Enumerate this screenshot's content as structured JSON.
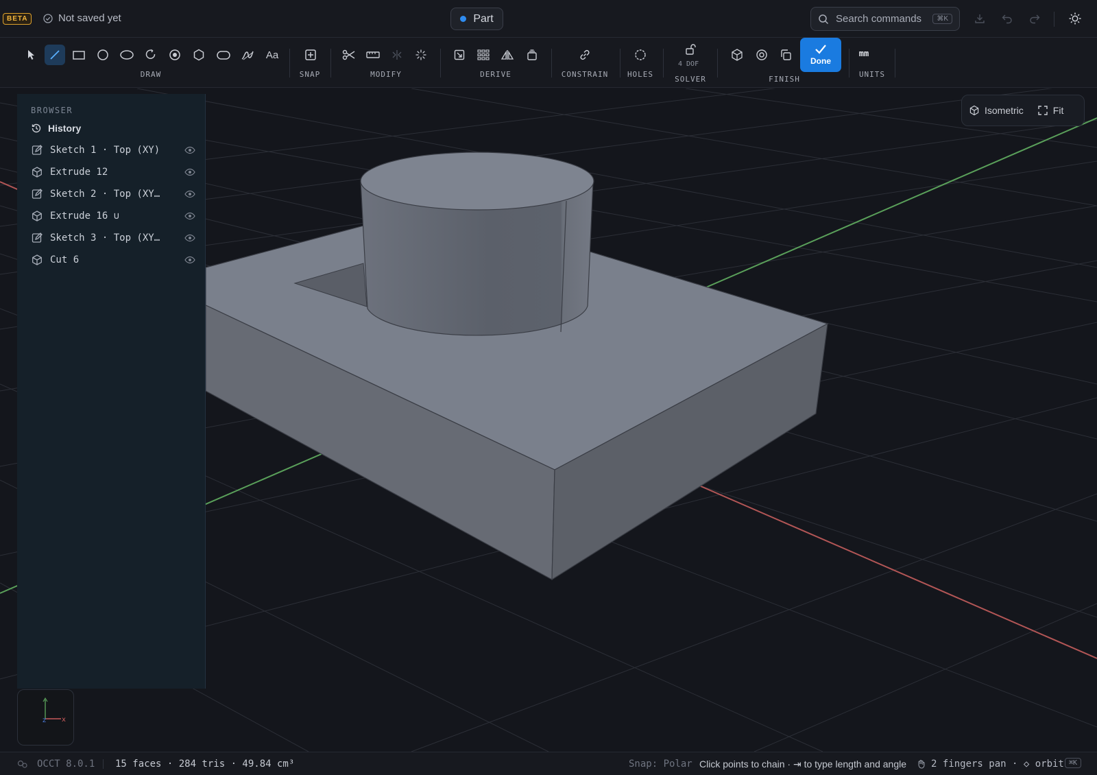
{
  "topbar": {
    "beta": "BETA",
    "save_status": "Not saved yet",
    "document_type": "Part",
    "search_placeholder": "Search commands",
    "search_shortcut": "⌘K"
  },
  "toolbar": {
    "groups": {
      "draw": "DRAW",
      "snap": "SNAP",
      "modify": "MODIFY",
      "derive": "DERIVE",
      "constrain": "CONSTRAIN",
      "holes": "HOLES",
      "solver": "SOLVER",
      "finish": "FINISH",
      "units": "UNITS"
    },
    "dof": "4 DOF",
    "done_label": "Done",
    "units_value": "mm",
    "text_tool": "Aa"
  },
  "browser": {
    "title": "BROWSER",
    "history_label": "History",
    "items": [
      {
        "label": "Sketch 1 · Top (XY)",
        "icon": "sketch-icon"
      },
      {
        "label": "Extrude 12",
        "icon": "cube-icon"
      },
      {
        "label": "Sketch 2 · Top (XY…",
        "icon": "sketch-icon"
      },
      {
        "label": "Extrude 16 ∪",
        "icon": "cube-icon"
      },
      {
        "label": "Sketch 3 · Top (XY…",
        "icon": "sketch-icon"
      },
      {
        "label": "Cut 6",
        "icon": "cube-icon"
      }
    ]
  },
  "view": {
    "isometric_label": "Isometric",
    "fit_label": "Fit"
  },
  "statusbar": {
    "kernel": "OCCT 8.0.1",
    "stats": "15 faces · 284 tris · 49.84 cm³",
    "snap": "Snap: Polar",
    "hint": "Click points to chain · ⇥ to type length and angle",
    "gesture": "2 fingers pan · ◇ orbit",
    "shortcut": "⌘K"
  },
  "colors": {
    "accent": "#1a7be0",
    "beta": "#f0b43c",
    "axis_x": "#c85a5a",
    "axis_y": "#5aa05a",
    "axis_z": "#4a7bdc"
  }
}
